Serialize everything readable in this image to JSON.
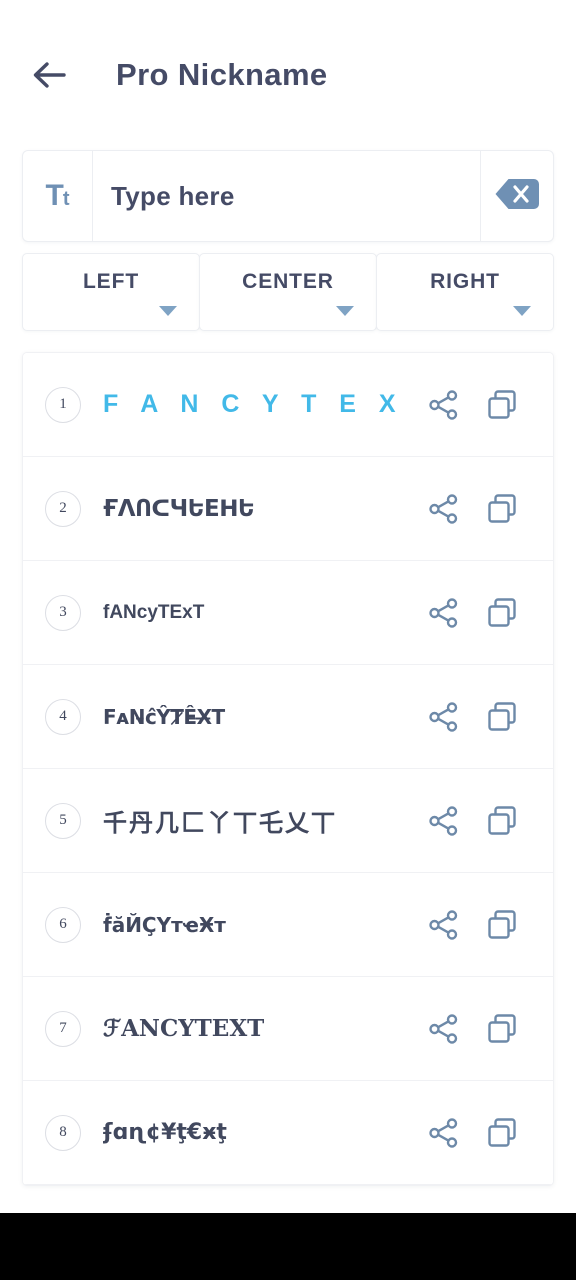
{
  "header": {
    "back_icon": "arrow-left-icon",
    "title": "Pro Nickname"
  },
  "input_bar": {
    "font_icon": "tt-font-icon",
    "font_icon_big": "T",
    "font_icon_small": "t",
    "placeholder": "Type here",
    "value": "",
    "clear_icon": "backspace-delete-icon"
  },
  "align_buttons": [
    {
      "label": "LEFT",
      "caret_icon": "chevron-down-icon"
    },
    {
      "label": "CENTER",
      "caret_icon": "chevron-down-icon"
    },
    {
      "label": "RIGHT",
      "caret_icon": "chevron-down-icon"
    }
  ],
  "colors": {
    "accent_cyan": "#42b9e8",
    "title_navy": "#454b66",
    "icon_steel": "#6f90b4",
    "icon_slate": "#6d89a8",
    "border_light": "#eceef2",
    "nav_bar": "#000000"
  },
  "style_list": {
    "share_icon": "share-icon",
    "copy_icon": "copy-icon",
    "rows": [
      {
        "index": "1",
        "text": "F A N C Y T E X T"
      },
      {
        "index": "2",
        "text": "ҒΛՈᑕЧԵEᕼԵ"
      },
      {
        "index": "3",
        "text": "fANcyTExT"
      },
      {
        "index": "4",
        "text": "ϜᴀN̵ᴄ̂ŶT̷Ê̵X̶T"
      },
      {
        "index": "5",
        "text": "千丹几匚丫丅乇乂丅"
      },
      {
        "index": "6",
        "text": "ḟӑЙҪҮтҽӾт"
      },
      {
        "index": "7",
        "text": "ℱANCYTEXT"
      },
      {
        "index": "8",
        "text": "ʄɑɳ¢¥ţ€ӿţ"
      }
    ]
  }
}
